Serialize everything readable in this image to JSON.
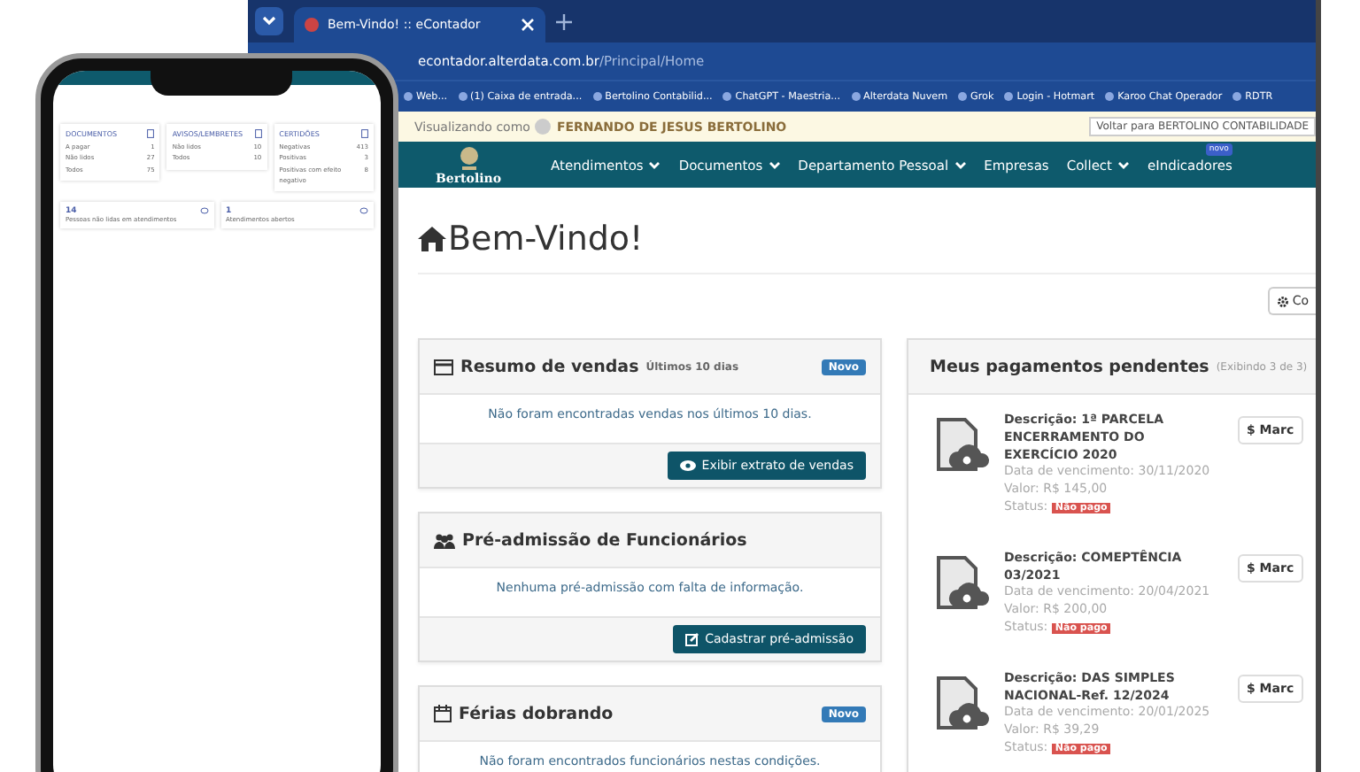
{
  "browser": {
    "tabs": [
      {
        "label": "Bem-Vindo! :: eContador",
        "selected": true
      }
    ],
    "address": {
      "host": "econtador.alterdata.com.br",
      "path": "/Principal/Home"
    },
    "bookmarks": [
      "Web...",
      "(1) Caixa de entrada...",
      "Bertolino Contabilid...",
      "ChatGPT - Maestria...",
      "Alterdata Nuvem",
      "Grok",
      "Login - Hotmart",
      "Karoo Chat Operador",
      "RDTR"
    ]
  },
  "impersonation_bar": {
    "label": "Visualizando como",
    "user": "FERNANDO DE JESUS BERTOLINO",
    "return_field": "Voltar para BERTOLINO CONTABILIDADE"
  },
  "nav": {
    "logo": "Bertolino",
    "items": [
      {
        "label": "Atendimentos",
        "dropdown": true
      },
      {
        "label": "Documentos",
        "dropdown": true
      },
      {
        "label": "Departamento Pessoal",
        "dropdown": true
      },
      {
        "label": "Empresas",
        "dropdown": false
      },
      {
        "label": "Collect",
        "dropdown": true
      },
      {
        "label": "eIndicadores",
        "dropdown": false,
        "badge": "novo"
      }
    ]
  },
  "page": {
    "title": "Bem-Vindo!",
    "config_button": "Co"
  },
  "panels": [
    {
      "kind": "sales",
      "title": "Resumo de vendas",
      "subtitle": "Últimos 10 dias",
      "badge": "Novo",
      "message": "Não foram encontradas vendas nos últimos 10 dias.",
      "button": "Exibir extrato de vendas"
    },
    {
      "kind": "admission",
      "title": "Pré-admissão de Funcionários",
      "message": "Nenhuma pré-admissão com falta de informação.",
      "button": "Cadastrar pré-admissão"
    },
    {
      "kind": "vacation",
      "title": "Férias dobrando",
      "badge": "Novo",
      "message": "Não foram encontrados funcionários nestas condições."
    }
  ],
  "payments": {
    "title": "Meus pagamentos pendentes",
    "count": "(Exibindo 3 de 3)",
    "items": [
      {
        "description": "Descrição: 1ª PARCELA ENCERRAMENTO DO EXERCÍCIO 2020",
        "due": "Data de vencimento: 30/11/2020",
        "value": "Valor: R$ 145,00",
        "status_label": "Status:",
        "status": "Não pago",
        "button": "$ Marc"
      },
      {
        "description": "Descrição: COMEPTÊNCIA 03/2021",
        "due": "Data de vencimento: 20/04/2021",
        "value": "Valor: R$ 200,00",
        "status_label": "Status:",
        "status": "Não pago",
        "button": "$ Marc"
      },
      {
        "description": "Descrição: DAS SIMPLES NACIONAL-Ref. 12/2024",
        "due": "Data de vencimento: 20/01/2025",
        "value": "Valor: R$ 39,29",
        "status_label": "Status:",
        "status": "Não pago",
        "button": "$ Marc"
      }
    ]
  },
  "phone": {
    "cards": [
      {
        "title": "DOCUMENTOS",
        "rows": [
          {
            "label": "A pagar",
            "value": "1"
          },
          {
            "label": "Não lidos",
            "value": "27"
          },
          {
            "label": "Todos",
            "value": "75"
          }
        ]
      },
      {
        "title": "AVISOS/LEMBRETES",
        "rows": [
          {
            "label": "Não lidos",
            "value": "10"
          },
          {
            "label": "Todos",
            "value": "10"
          }
        ]
      },
      {
        "title": "CERTIDÕES",
        "rows": [
          {
            "label": "Negativas",
            "value": "413"
          },
          {
            "label": "Positivas",
            "value": "3"
          },
          {
            "label": "Positivas com efeito negativo",
            "value": "8"
          }
        ]
      }
    ],
    "stats": [
      {
        "value": "14",
        "label": "Pessoas não lidas em atendimentos"
      },
      {
        "value": "1",
        "label": "Atendimentos abertos"
      }
    ]
  }
}
